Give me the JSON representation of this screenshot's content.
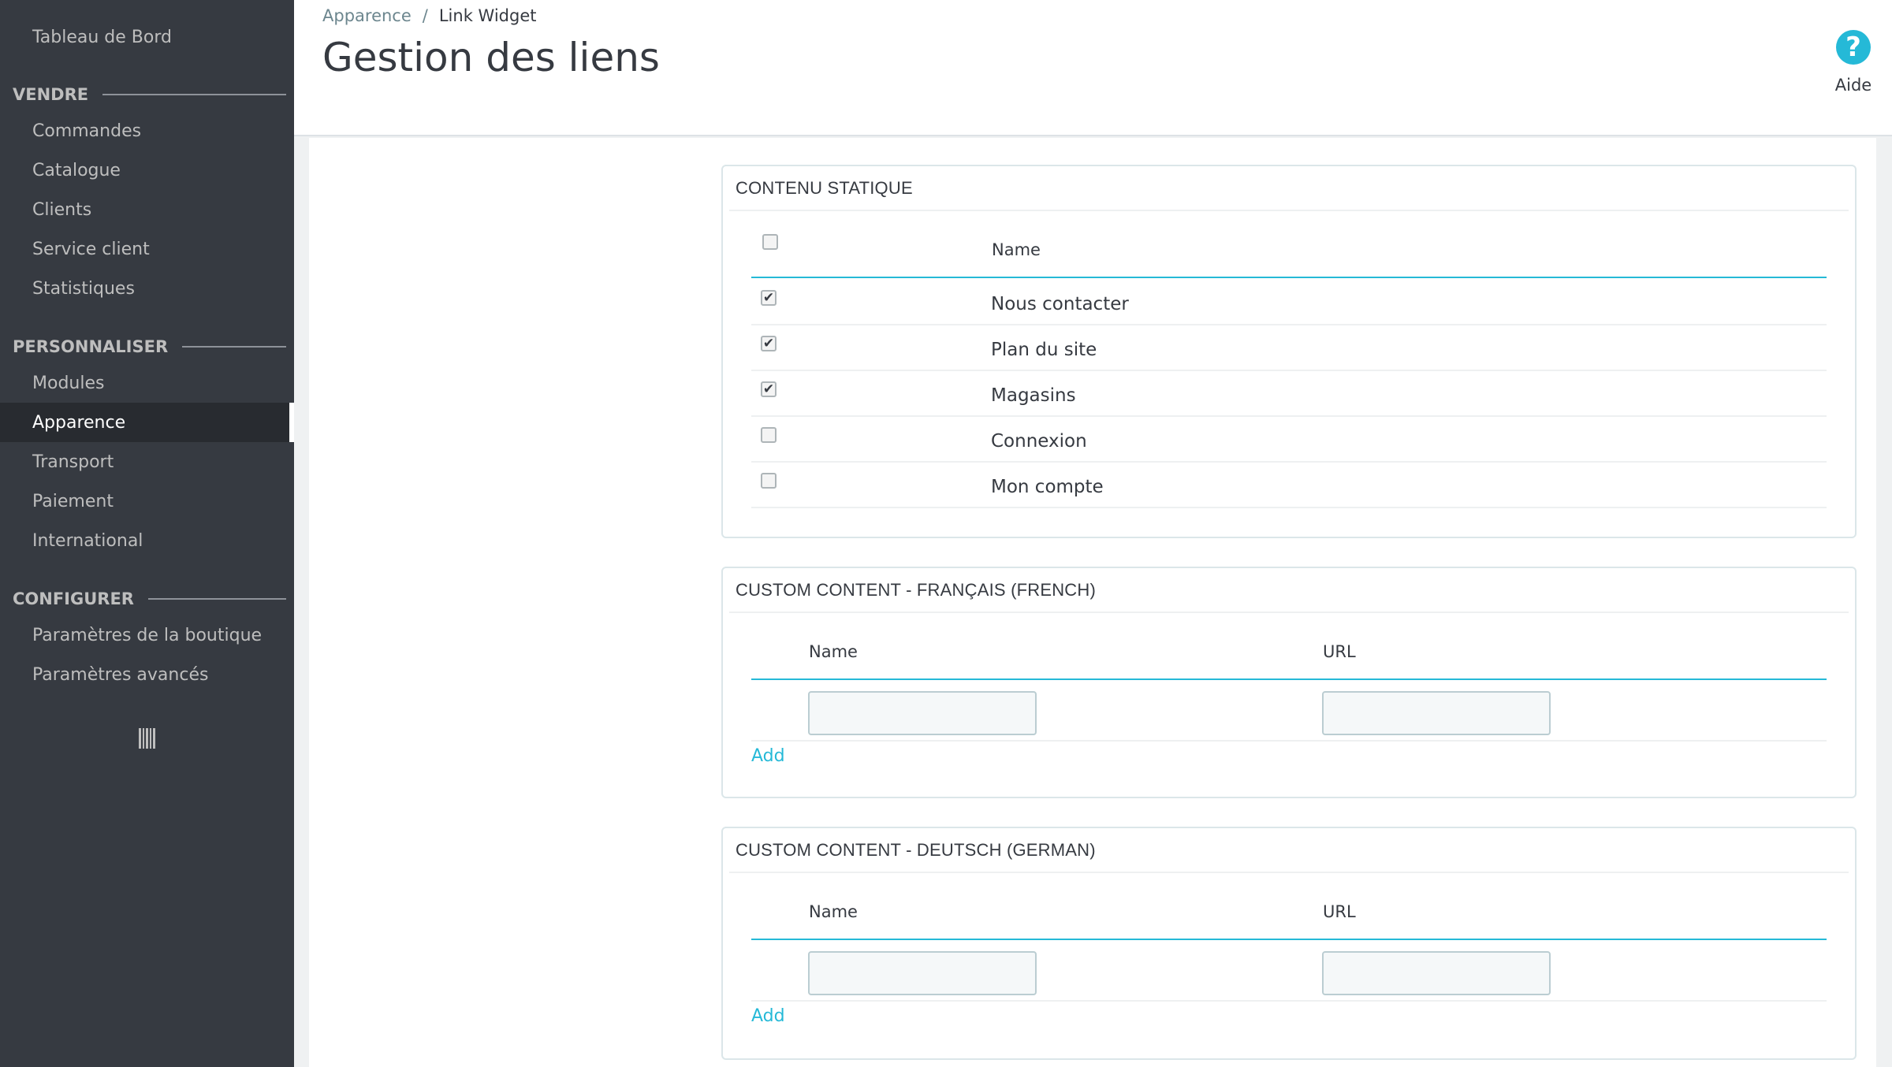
{
  "sidebar": {
    "dashboard": "Tableau de Bord",
    "sections": [
      {
        "title": "VENDRE",
        "items": [
          "Commandes",
          "Catalogue",
          "Clients",
          "Service client",
          "Statistiques"
        ]
      },
      {
        "title": "PERSONNALISER",
        "items": [
          "Modules",
          "Apparence",
          "Transport",
          "Paiement",
          "International"
        ]
      },
      {
        "title": "CONFIGURER",
        "items": [
          "Paramètres de la boutique",
          "Paramètres avancés"
        ]
      }
    ],
    "active_item": "Apparence",
    "collapse_icon": "barcode-icon"
  },
  "header": {
    "breadcrumb": {
      "parent": "Apparence",
      "separator": "/",
      "current": "Link Widget"
    },
    "title": "Gestion des liens",
    "help": {
      "label": "Aide",
      "icon": "question-circle-icon",
      "glyph": "?"
    }
  },
  "static_content": {
    "title": "CONTENU STATIQUE",
    "column_name": "Name",
    "rows": [
      {
        "name": "Nous contacter",
        "checked": true
      },
      {
        "name": "Plan du site",
        "checked": true
      },
      {
        "name": "Magasins",
        "checked": true
      },
      {
        "name": "Connexion",
        "checked": false
      },
      {
        "name": "Mon compte",
        "checked": false
      }
    ]
  },
  "custom_fr": {
    "title": "CUSTOM CONTENT - FRANÇAIS (FRENCH)",
    "col_name": "Name",
    "col_url": "URL",
    "name_value": "",
    "url_value": "",
    "add_label": "Add"
  },
  "custom_de": {
    "title": "CUSTOM CONTENT - DEUTSCH (GERMAN)",
    "col_name": "Name",
    "col_url": "URL",
    "name_value": "",
    "url_value": "",
    "add_label": "Add"
  },
  "colors": {
    "sidebar_bg": "#363a41",
    "accent": "#25b9d7",
    "page_bg": "#eff1f2"
  }
}
